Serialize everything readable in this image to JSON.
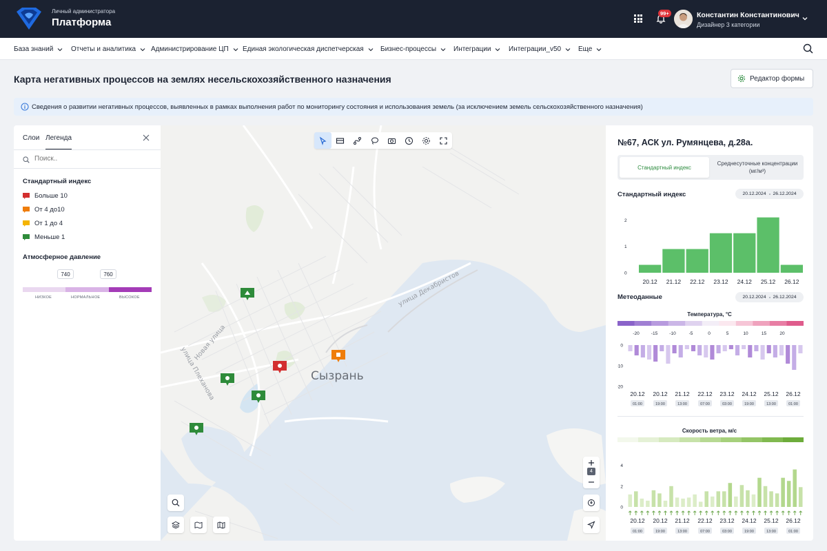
{
  "header": {
    "subtitle": "Личный администратора",
    "title": "Платформа",
    "notifications_badge": "99+",
    "user_name": "Константин Константинович",
    "user_role": "Дизайнер 3 категории"
  },
  "nav": {
    "items": [
      "База знаний",
      "Отчеты и аналитика",
      "Администрирование ЦП",
      "Единая экологическая диспетчерская",
      "Бизнес-процессы",
      "Интеграции",
      "Интеграции_v50",
      "Еще"
    ]
  },
  "page": {
    "title": "Карта негативных процессов на землях несельскохозяйственного назначения",
    "editor_button": "Редактор формы",
    "info_text": "Сведения о развитии негативных процессов, выявленных в рамках выполнения работ по мониторингу состояния и использования земель (за исключением земель сельскохозяйственного назначения)"
  },
  "left_panel": {
    "tabs": [
      "Слои",
      "Легенда"
    ],
    "active_tab": "Легенда",
    "search_placeholder": "Поиск..",
    "standard_index_title": "Стандартный индекс",
    "legend": [
      {
        "label": "Больше 10",
        "color": "#d32f2f"
      },
      {
        "label": "От 4 до10",
        "color": "#ef7d0b"
      },
      {
        "label": "От 1 до 4",
        "color": "#f4b400"
      },
      {
        "label": "Меньше 1",
        "color": "#2e8b3a"
      }
    ],
    "pressure_title": "Атмосферное давление",
    "pressure_values": [
      "740",
      "760"
    ],
    "pressure_labels": [
      "НИЗКОЕ",
      "НОРМАЛЬНОЕ",
      "ВЫСОКОЕ"
    ]
  },
  "map": {
    "city": "Сызрань",
    "streets": [
      "улица Декабристов",
      "Новая улица",
      "улица Плеханова"
    ],
    "zoom_level": "4",
    "tools": [
      "select-icon",
      "card-icon",
      "route-icon",
      "lasso-icon",
      "camera-icon",
      "clock-icon",
      "gear-icon",
      "fullscreen-icon"
    ]
  },
  "right_panel": {
    "station_title": "№67, АСК ул. Румянцева, д.28а.",
    "segment_tabs": [
      "Стандартный индекс",
      "Среднесуточные концентрации (мг/м³)"
    ],
    "active_segment": "Стандартный индекс",
    "index_title": "Стандартный индекс",
    "date_from": "20.12.2024",
    "date_to": "26.12.2024",
    "meteo_title": "Метеоданные",
    "temp_title": "Температура, °C",
    "temp_scale": [
      "-20",
      "-15",
      "-10",
      "-5",
      "0",
      "5",
      "10",
      "15",
      "20"
    ],
    "wind_title": "Скорость ветра, м/с",
    "dates": [
      "20.12",
      "21.12",
      "22.12",
      "23.12",
      "24.12",
      "25.12",
      "26.12"
    ],
    "times": [
      "01:00",
      "19:00",
      "13:00",
      "07:00",
      "03:00",
      "19:00",
      "13:00",
      "01:00"
    ],
    "colors": {
      "green": "#5cbf69",
      "purple": "#b08ad8",
      "wind": "#c7e2a9"
    }
  },
  "chart_data": [
    {
      "type": "bar",
      "title": "Стандартный индекс",
      "categories": [
        "20.12",
        "21.12",
        "22.12",
        "23.12",
        "24.12",
        "25.12",
        "26.12"
      ],
      "values": [
        0.3,
        0.9,
        0.9,
        1.5,
        1.5,
        2.1,
        0.3
      ],
      "ylim": [
        0,
        2.3
      ],
      "yticks": [
        0,
        1,
        2
      ]
    },
    {
      "type": "bar",
      "title": "Температура, °C",
      "categories": [
        "20.12",
        "20.12",
        "21.12",
        "22.12",
        "23.12",
        "24.12",
        "25.12",
        "26.12"
      ],
      "values": [
        -3,
        -5,
        -6,
        -7,
        -8,
        -3,
        -9,
        -4,
        -6,
        -2,
        -3,
        -5,
        -6,
        -7,
        -4,
        -3,
        -2,
        -5,
        -2,
        -6,
        -3,
        -7,
        -4,
        -6,
        -5,
        -9,
        -12,
        -4
      ],
      "ylim": [
        -20,
        0
      ],
      "yticks": [
        0,
        -10,
        -20
      ]
    },
    {
      "type": "bar",
      "title": "Скорость ветра, м/с",
      "categories": [
        "20.12",
        "20.12",
        "21.12",
        "22.12",
        "23.12",
        "24.12",
        "25.12",
        "26.12"
      ],
      "values": [
        1.2,
        1.5,
        0.8,
        0.6,
        1.6,
        1.3,
        0.6,
        2.0,
        0.9,
        0.8,
        0.9,
        1.2,
        0.5,
        1.5,
        1.0,
        1.5,
        1.5,
        2.3,
        1.0,
        2.1,
        1.6,
        1.2,
        2.8,
        2.0,
        1.5,
        1.3,
        2.8,
        2.5,
        3.6,
        1.9
      ],
      "ylim": [
        0,
        4.5
      ],
      "yticks": [
        0,
        2,
        4
      ]
    }
  ]
}
